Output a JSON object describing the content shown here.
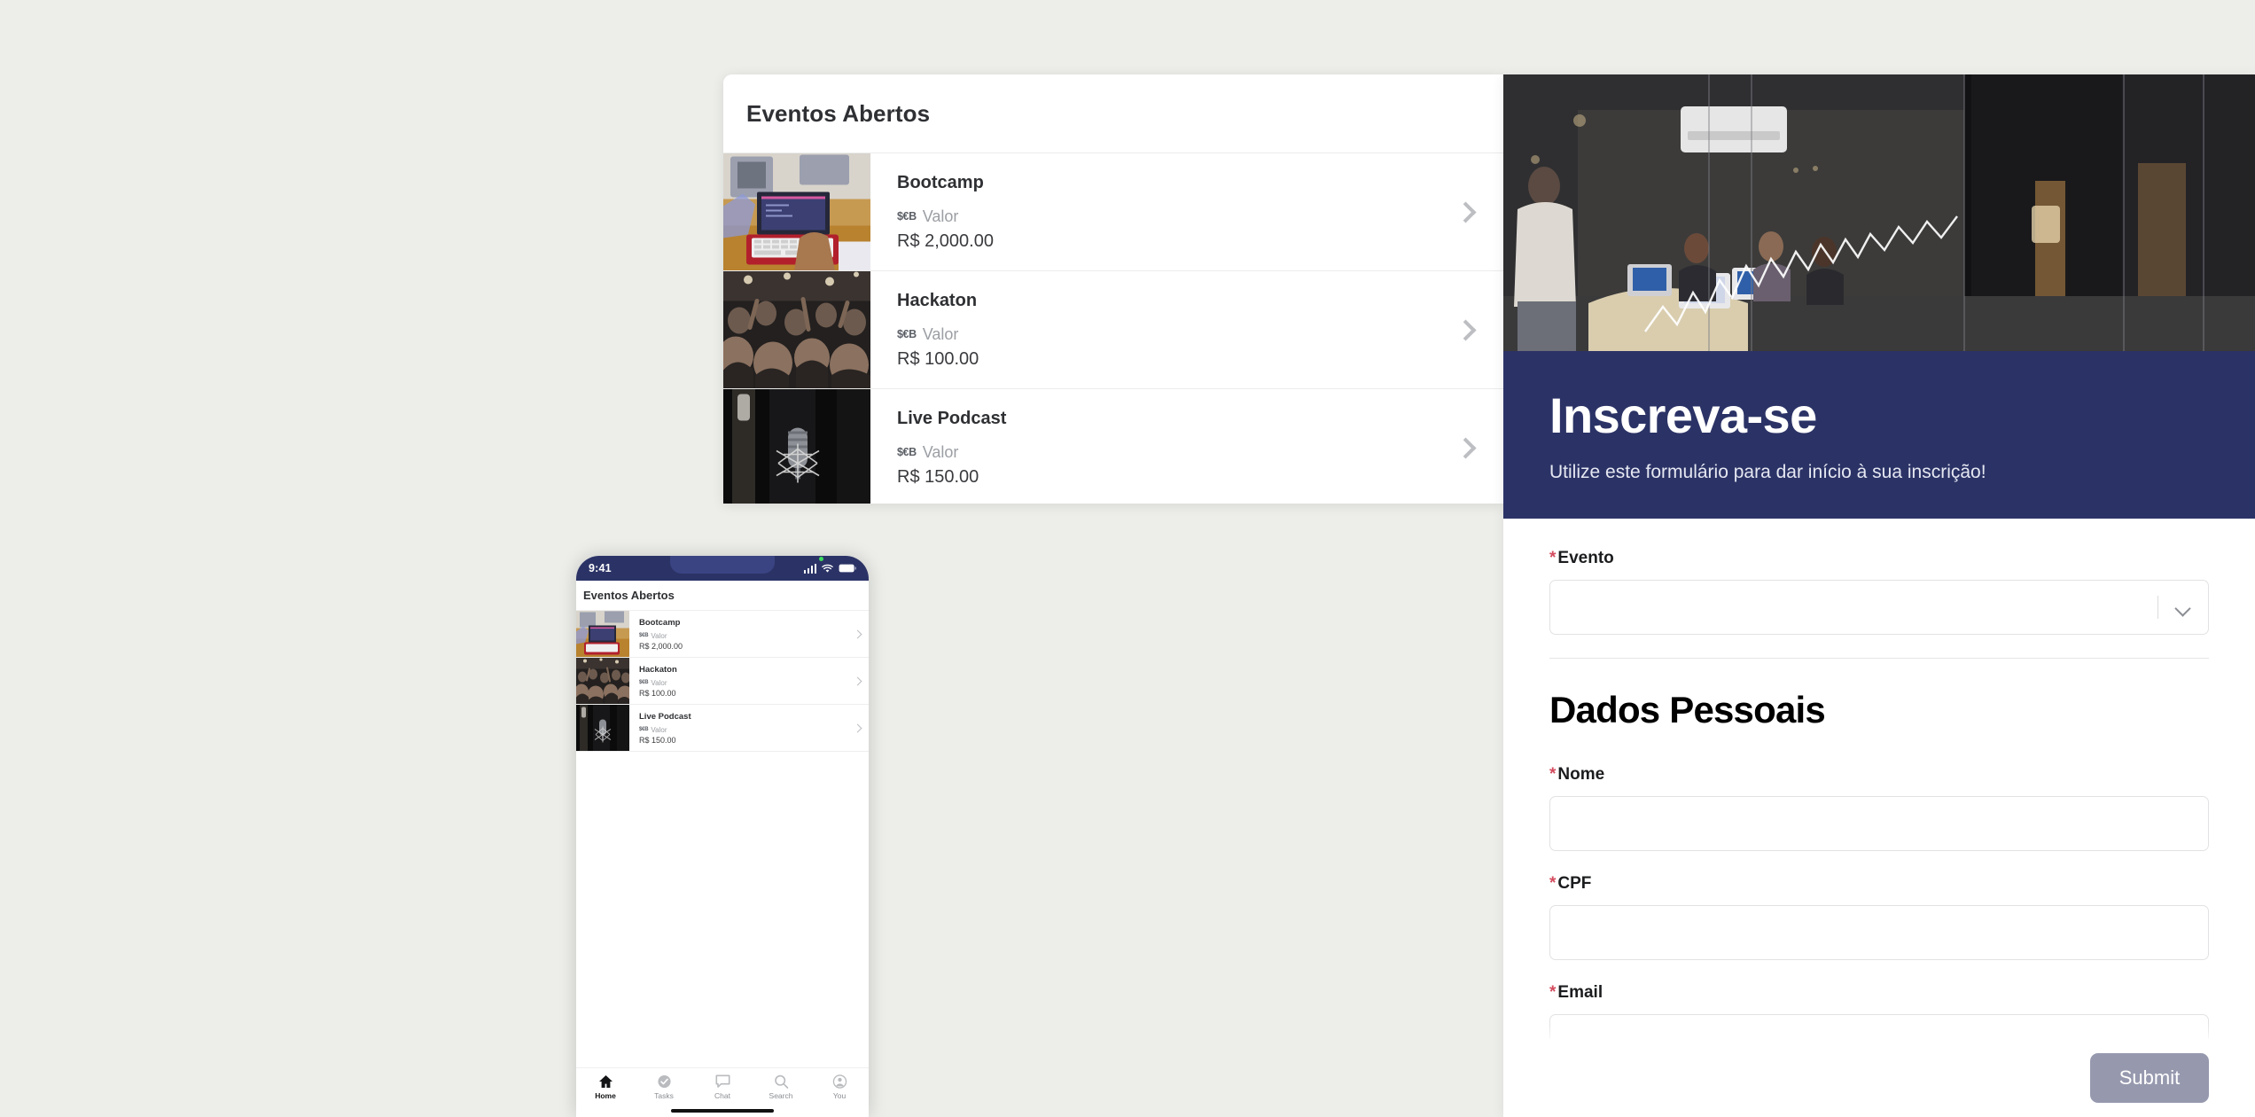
{
  "desktop_events_card": {
    "title": "Eventos Abertos",
    "rows": [
      {
        "name": "Bootcamp",
        "valor_label": "Valor",
        "coin_icon": "currency-icon",
        "price": "R$ 2,000.00",
        "thumb": "laptops-workshop-photo"
      },
      {
        "name": "Hackaton",
        "valor_label": "Valor",
        "coin_icon": "currency-icon",
        "price": "R$ 100.00",
        "thumb": "crowd-concert-photo"
      },
      {
        "name": "Live Podcast",
        "valor_label": "Valor",
        "coin_icon": "currency-icon",
        "price": "R$ 150.00",
        "thumb": "microphone-studio-photo"
      }
    ],
    "chevron_icon": "chevron-right-icon",
    "coin_glyph": "$€B"
  },
  "form_panel": {
    "hero_image": "coworking-office-photo",
    "hero_title": "Inscreva-se",
    "hero_subtitle": "Utilize este formulário para dar início à sua inscrição!",
    "required_mark": "*",
    "event_field": {
      "label": "Evento",
      "value": "",
      "placeholder": "",
      "caret_icon": "chevron-down-icon"
    },
    "section_title": "Dados Pessoais",
    "fields": [
      {
        "label": "Nome",
        "value": "",
        "placeholder": ""
      },
      {
        "label": "CPF",
        "value": "",
        "placeholder": ""
      },
      {
        "label": "Email",
        "value": "",
        "placeholder": ""
      }
    ],
    "submit_label": "Submit",
    "colors": {
      "hero_band": "#2b3366",
      "required": "#d44b5e",
      "submit_bg": "#9699ae"
    }
  },
  "phone": {
    "status_bar": {
      "time": "9:41",
      "signal_icon": "signal-bars-icon",
      "wifi_icon": "wifi-icon",
      "battery_icon": "battery-icon",
      "indicator_icon": "green-dot-icon"
    },
    "header_title": "Eventos Abertos",
    "rows": [
      {
        "name": "Bootcamp",
        "valor_label": "Valor",
        "price": "R$ 2,000.00",
        "thumb": "laptops-workshop-photo"
      },
      {
        "name": "Hackaton",
        "valor_label": "Valor",
        "price": "R$ 100.00",
        "thumb": "crowd-concert-photo"
      },
      {
        "name": "Live Podcast",
        "valor_label": "Valor",
        "price": "R$ 150.00",
        "thumb": "microphone-studio-photo"
      }
    ],
    "coin_glyph": "$€B",
    "tabs": [
      {
        "label": "Home",
        "icon": "home-icon",
        "active": true
      },
      {
        "label": "Tasks",
        "icon": "check-circle-icon",
        "active": false
      },
      {
        "label": "Chat",
        "icon": "chat-bubble-icon",
        "active": false
      },
      {
        "label": "Search",
        "icon": "search-icon",
        "active": false
      },
      {
        "label": "You",
        "icon": "person-circle-icon",
        "active": false
      }
    ]
  },
  "page": {
    "background": "#edeeea"
  }
}
